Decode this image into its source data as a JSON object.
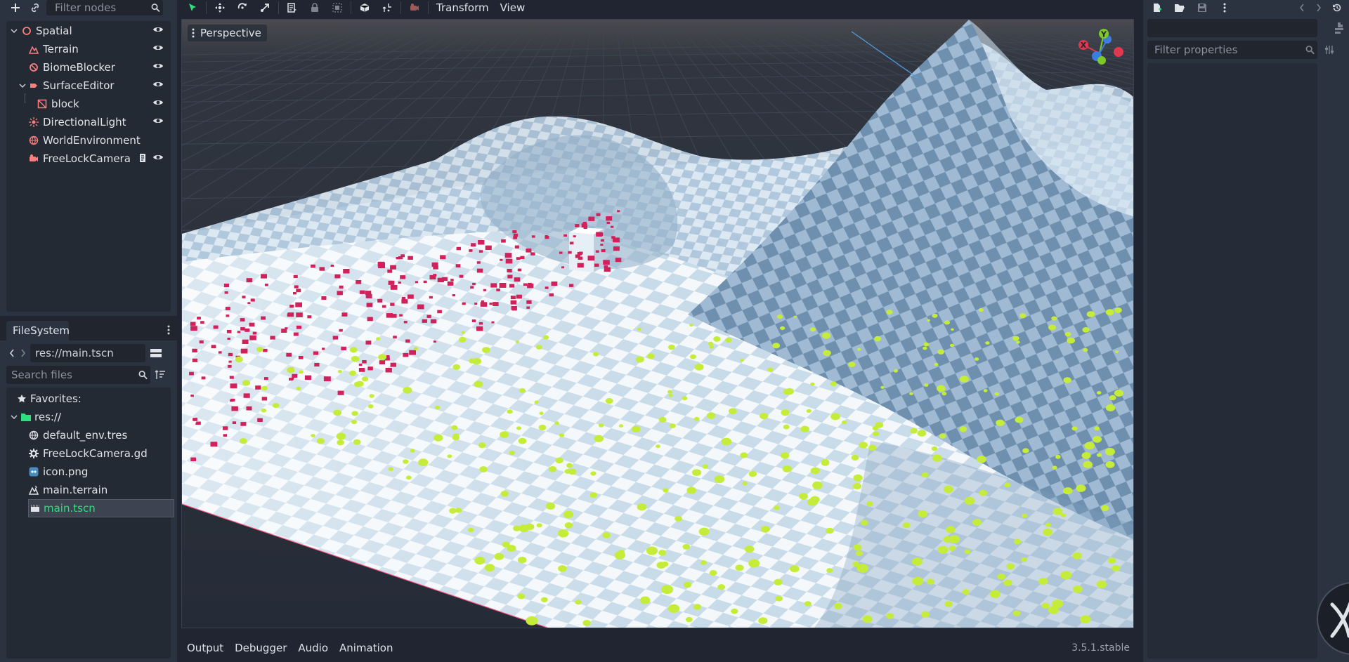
{
  "scene_dock": {
    "filter_placeholder": "Filter nodes",
    "nodes": [
      {
        "label": "Spatial",
        "icon": "spatial-node-icon",
        "expanded": true,
        "visible": true
      },
      {
        "label": "Terrain",
        "icon": "terrain-node-icon",
        "visible": true
      },
      {
        "label": "BiomeBlocker",
        "icon": "biome-blocker-icon",
        "visible": true
      },
      {
        "label": "SurfaceEditor",
        "icon": "surface-editor-icon",
        "expanded": true,
        "visible": true
      },
      {
        "label": "block",
        "icon": "mesh-instance-icon",
        "visible": true
      },
      {
        "label": "DirectionalLight",
        "icon": "directional-light-icon",
        "visible": true
      },
      {
        "label": "WorldEnvironment",
        "icon": "world-environment-icon"
      },
      {
        "label": "FreeLockCamera",
        "icon": "camera-icon",
        "has_script": true,
        "visible": true
      }
    ]
  },
  "filesystem": {
    "tab_label": "FileSystem",
    "path": "res://main.tscn",
    "search_placeholder": "Search files",
    "favorites_label": "Favorites:",
    "root_label": "res://",
    "files": [
      {
        "name": "default_env.tres",
        "icon": "environment-icon"
      },
      {
        "name": "FreeLockCamera.gd",
        "icon": "gear-icon"
      },
      {
        "name": "icon.png",
        "icon": "image-icon"
      },
      {
        "name": "main.terrain",
        "icon": "terrain-file-icon"
      },
      {
        "name": "main.tscn",
        "icon": "scene-icon",
        "selected": true
      }
    ]
  },
  "viewport_toolbar": {
    "menus": [
      "Transform",
      "View"
    ]
  },
  "viewport": {
    "perspective_label": "Perspective",
    "gizmo_axis_y": "Y",
    "gizmo_axis_x": "X"
  },
  "bottom_panel": {
    "tabs": [
      "Output",
      "Debugger",
      "Audio",
      "Animation"
    ],
    "version": "3.5.1.stable"
  },
  "inspector": {
    "filter_placeholder": "Filter properties"
  },
  "colors": {
    "accent_green": "#2ee07d",
    "axis_x": "#e0384d",
    "axis_y": "#7ec82a",
    "axis_z": "#3b7ee0",
    "marker_red": "#d0215a",
    "marker_green": "#c6ec3a"
  }
}
